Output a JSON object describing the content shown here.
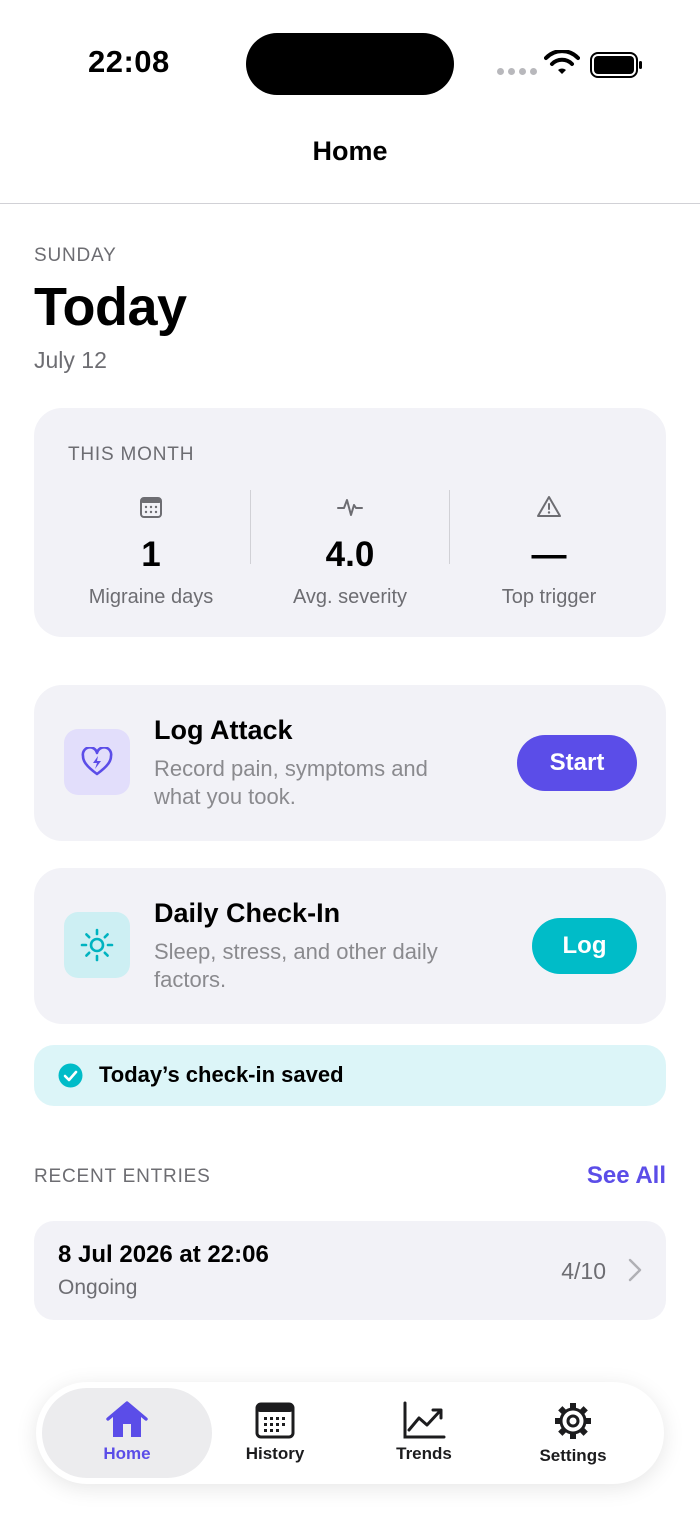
{
  "status_bar": {
    "time": "22:08"
  },
  "nav": {
    "title": "Home"
  },
  "header": {
    "day": "SUNDAY",
    "title": "Today",
    "date": "July 12"
  },
  "this_month": {
    "title": "THIS MONTH",
    "stats": [
      {
        "icon": "calendar-icon",
        "value": "1",
        "label": "Migraine days"
      },
      {
        "icon": "pulse-icon",
        "value": "4.0",
        "label": "Avg. severity"
      },
      {
        "icon": "warning-icon",
        "value": "—",
        "label": "Top trigger"
      }
    ]
  },
  "log_attack": {
    "title": "Log Attack",
    "description": "Record pain, symptoms and what you took.",
    "button": "Start",
    "icon": "heart-bolt-icon",
    "accent": "#5b4de8"
  },
  "daily_checkin": {
    "title": "Daily Check-In",
    "description": "Sleep, stress, and other daily factors.",
    "button": "Log",
    "icon": "sun-icon",
    "accent": "#00bcc8"
  },
  "saved_banner": {
    "text": "Today’s check-in saved"
  },
  "recent": {
    "label": "RECENT ENTRIES",
    "see_all": "See All",
    "entries": [
      {
        "date": "8 Jul 2026 at 22:06",
        "status": "Ongoing",
        "score": "4/10"
      }
    ]
  },
  "tabs": [
    {
      "label": "Home",
      "icon": "house-icon",
      "active": true
    },
    {
      "label": "History",
      "icon": "calendar-icon",
      "active": false
    },
    {
      "label": "Trends",
      "icon": "chart-icon",
      "active": false
    },
    {
      "label": "Settings",
      "icon": "gear-icon",
      "active": false
    }
  ]
}
